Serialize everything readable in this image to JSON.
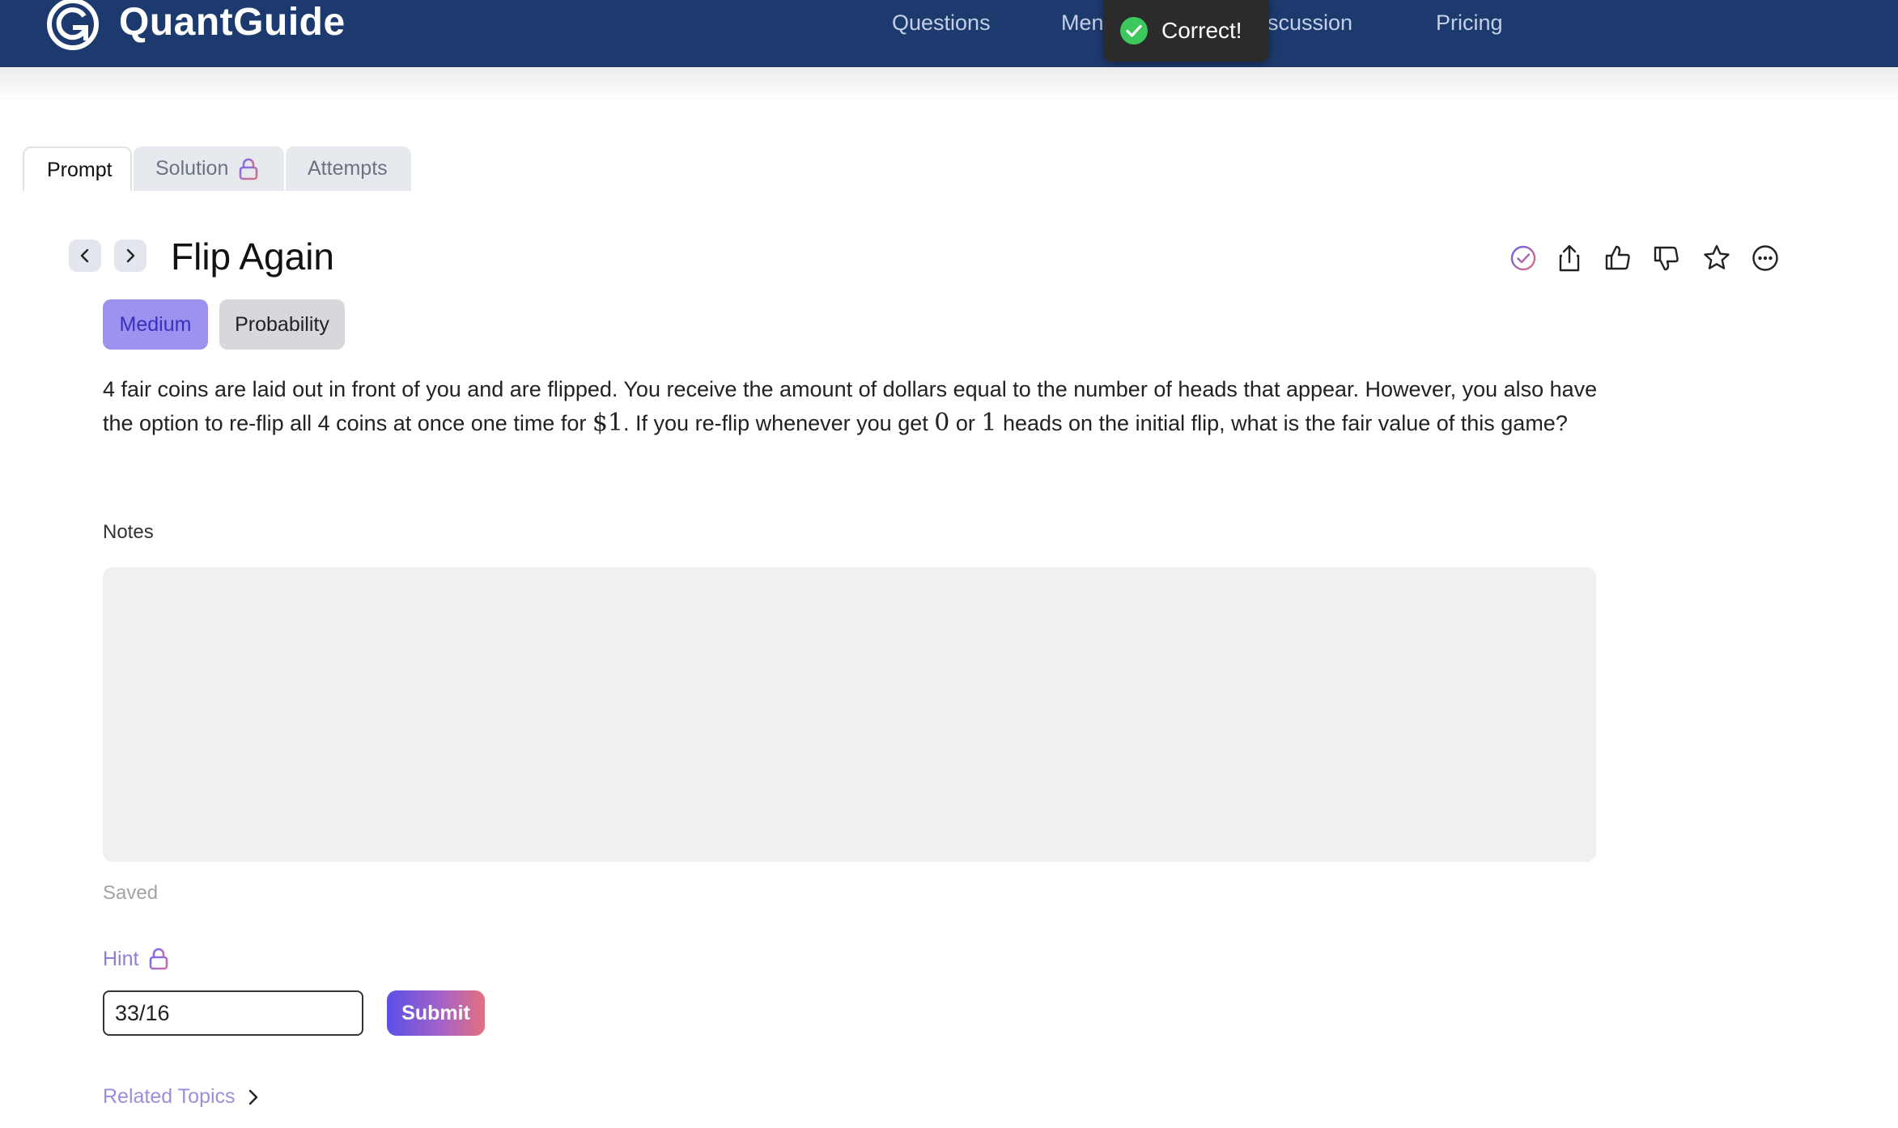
{
  "app": {
    "logo_text": "QuantGuide",
    "logo_icon": "quantguide-logo-icon"
  },
  "nav": {
    "links": [
      "Questions",
      "Men",
      "iscussion",
      "Pricing"
    ]
  },
  "toast": {
    "text": "Correct!",
    "icon": "check-circle-icon",
    "color": "#3cc85c"
  },
  "tabs": [
    {
      "label": "Prompt",
      "active": true
    },
    {
      "label": "Solution",
      "locked": true,
      "icon": "lock-icon"
    },
    {
      "label": "Attempts"
    }
  ],
  "question": {
    "title": "Flip Again",
    "difficulty": "Medium",
    "topic": "Probability",
    "prompt_parts": [
      "4 fair coins are laid out in front of you and are flipped. You receive the amount of dollars equal to the number of heads that appear. However, you also have the option to re-flip all 4 coins at once one time for ",
      "$1",
      ". If you re-flip whenever you get ",
      "0",
      " or ",
      "1",
      " heads on the initial flip, what is the fair value of this game?"
    ]
  },
  "actions": [
    "solved-check-icon",
    "share-icon",
    "thumbs-up-icon",
    "thumbs-down-icon",
    "star-icon",
    "more-options-icon"
  ],
  "notes": {
    "label": "Notes",
    "value": "",
    "status": "Saved"
  },
  "hint": {
    "label": "Hint",
    "icon": "lock-icon"
  },
  "answer": {
    "value": "33/16",
    "submit_label": "Submit"
  },
  "related_topics": {
    "label": "Related Topics",
    "icon": "chevron-right-icon"
  },
  "colors": {
    "nav_bg": "#1d3a6e",
    "accent": "#9b93ef",
    "submit_gradient": [
      "#5a50e6",
      "#e2707f"
    ]
  }
}
